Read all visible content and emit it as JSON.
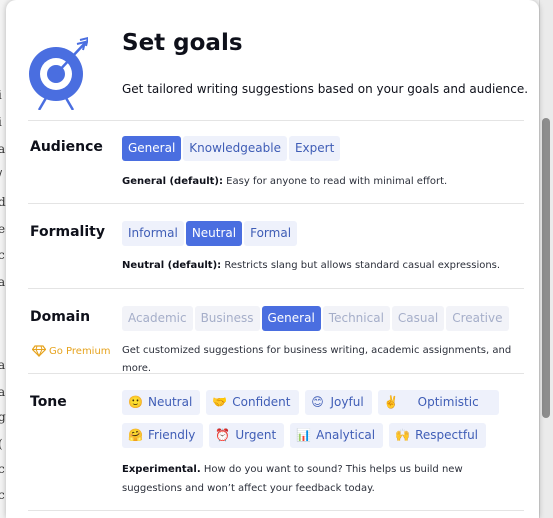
{
  "dialog": {
    "title": "Set goals",
    "subtitle": "Get tailored writing suggestions based on your goals and audience."
  },
  "audience": {
    "label": "Audience",
    "options": [
      "General",
      "Knowledgeable",
      "Expert"
    ],
    "selected": "General",
    "desc_bold": "General (default):",
    "desc_text": " Easy for anyone to read with minimal effort."
  },
  "formality": {
    "label": "Formality",
    "options": [
      "Informal",
      "Neutral",
      "Formal"
    ],
    "selected": "Neutral",
    "desc_bold": "Neutral (default):",
    "desc_text": " Restricts slang but allows standard casual expressions."
  },
  "domain": {
    "label": "Domain",
    "premium_label": "Go Premium",
    "options": [
      "Academic",
      "Business",
      "General",
      "Technical",
      "Casual",
      "Creative"
    ],
    "selected": "General",
    "desc_text": "Get customized suggestions for business writing, academic assignments, and more."
  },
  "tone": {
    "label": "Tone",
    "row1": [
      {
        "label": "Neutral",
        "emoji": "🙂"
      },
      {
        "label": "Confident",
        "emoji": "🤝"
      },
      {
        "label": "Joyful",
        "emoji": "😊"
      },
      {
        "label": "Optimistic",
        "emoji": "✌️"
      }
    ],
    "row2": [
      {
        "label": "Friendly",
        "emoji": "🤗"
      },
      {
        "label": "Urgent",
        "emoji": "⏰"
      },
      {
        "label": "Analytical",
        "emoji": "📊"
      },
      {
        "label": "Respectful",
        "emoji": "🙌"
      }
    ],
    "desc_bold": "Experimental.",
    "desc_text": " How do you want to sound? This helps us build new suggestions and won’t affect your feedback today."
  },
  "background_letters": [
    "i",
    "i",
    "a",
    "/",
    "d",
    "e",
    "c",
    "a",
    "a",
    "a",
    "g",
    "(",
    "c",
    "c"
  ],
  "colors": {
    "accent": "#4a6ee0",
    "chip_bg": "#eef1fb",
    "chip_text": "#3f5db6",
    "premium": "#e6a31e"
  }
}
